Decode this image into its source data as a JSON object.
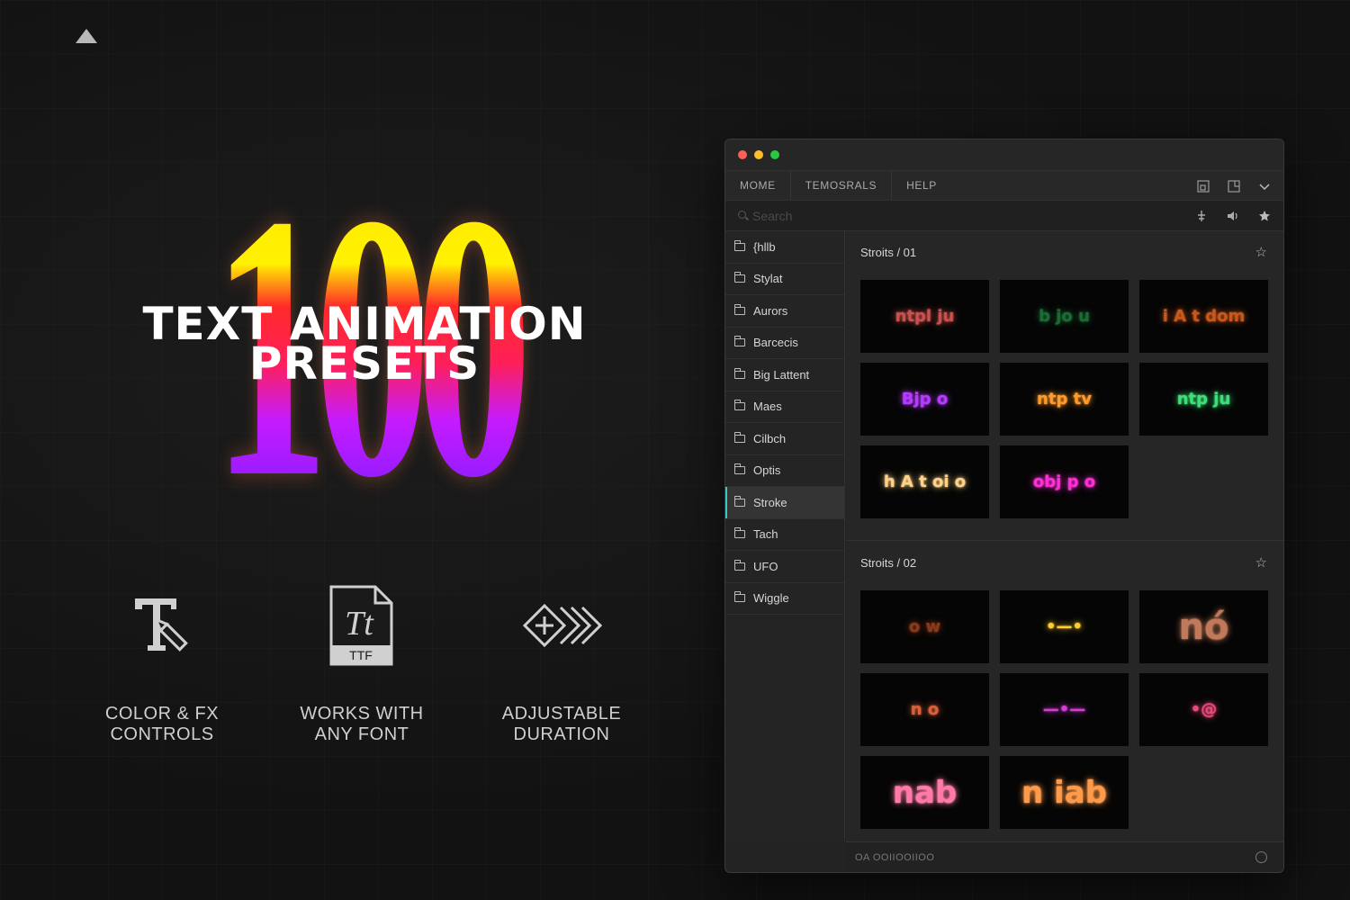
{
  "hero": {
    "number": "100",
    "title_line1": "TEXT ANIMATION",
    "title_line2": "PRESETS"
  },
  "features": [
    {
      "label_line1": "COLOR & FX",
      "label_line2": "CONTROLS",
      "icon": "text-pen-icon"
    },
    {
      "label_line1": "WORKS WITH",
      "label_line2": "ANY FONT",
      "icon": "ttf-file-icon",
      "badge": "TTF",
      "glyph": "Tt"
    },
    {
      "label_line1": "ADJUSTABLE",
      "label_line2": "DURATION",
      "icon": "fast-forward-diamond-icon"
    }
  ],
  "window": {
    "nav": {
      "tabs": [
        "MOME",
        "TEMOSRALS",
        "HELP"
      ]
    },
    "search": {
      "placeholder": "Search"
    },
    "sidebar": {
      "items": [
        "{hllb",
        "Stylat",
        "Aurors",
        "Barcecis",
        "Big Lattent",
        "Maes",
        "Cilbch",
        "Optis",
        "Stroke",
        "Tach",
        "UFO",
        "Wiggle"
      ],
      "active_index": 8
    },
    "sections": [
      {
        "title": "Stroits / 01",
        "thumbs": [
          {
            "text": "ntpl ju",
            "color": "#c9524f"
          },
          {
            "text": "b  jo   u",
            "color": "#1d6b34"
          },
          {
            "text": "i A t dom",
            "color": "#c7591f"
          },
          {
            "text": "Bjp  o",
            "color": "#b63bff"
          },
          {
            "text": "ntp tv",
            "color": "#ff9a2b"
          },
          {
            "text": "ntp ju",
            "color": "#3fe07a"
          },
          {
            "text": "h  A t oi  o",
            "color": "#ffd28a"
          },
          {
            "text": "obj p   o",
            "color": "#ff2fd6"
          }
        ]
      },
      {
        "title": "Stroits / 02",
        "thumbs": [
          {
            "text": "o  w",
            "color": "#8a3a1a"
          },
          {
            "text": "•—•",
            "color": "#ffcc33"
          },
          {
            "text": "nó",
            "color": "#c0795a"
          },
          {
            "text": "n  o",
            "color": "#d9603a"
          },
          {
            "text": "—•—",
            "color": "#d63bd6"
          },
          {
            "text": "•@",
            "color": "#e84b7a"
          },
          {
            "text": "nab",
            "color": "#ff7aa8"
          },
          {
            "text": "n iab",
            "color": "#ff9a4a"
          }
        ]
      }
    ],
    "footer": {
      "text": "OA OOIIOOIIOO"
    }
  },
  "colors": {
    "accent": "#36c7c7",
    "gradient_top": "#ffe600",
    "gradient_mid": "#ff2a2a",
    "gradient_bottom": "#7d1cff"
  }
}
